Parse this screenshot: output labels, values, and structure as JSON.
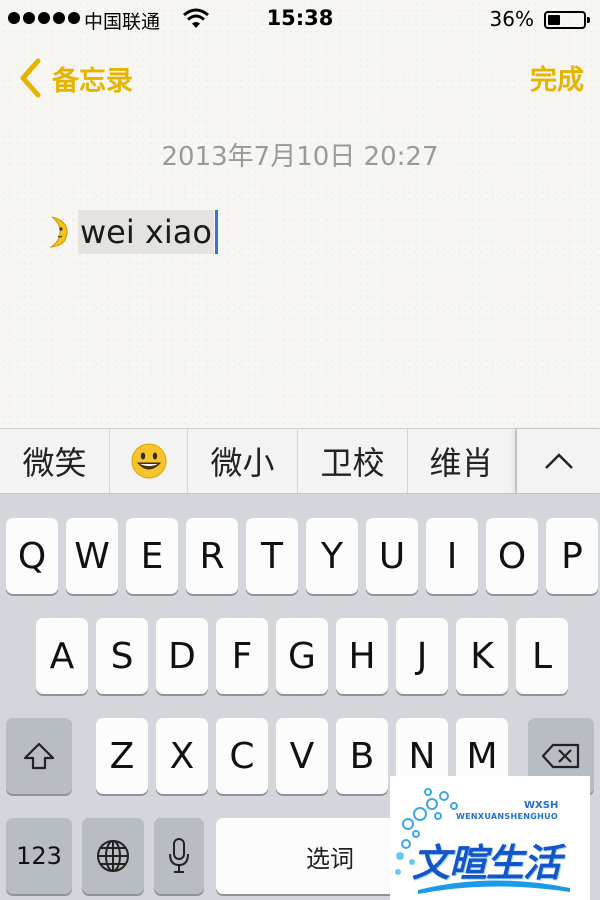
{
  "status_bar": {
    "carrier": "中国联通",
    "time": "15:38",
    "battery_percent": "36%",
    "battery_level": 0.36
  },
  "nav": {
    "back_label": "备忘录",
    "done_label": "完成",
    "accent_color": "#e6b400"
  },
  "note": {
    "date": "2013年7月10日 20:27",
    "text": "wei xiao"
  },
  "candidates": {
    "items": [
      "微笑",
      "smiling-face-emoji",
      "微小",
      "卫校",
      "维肖"
    ],
    "expand_icon": "chevron-up-icon"
  },
  "keyboard": {
    "row1": [
      "Q",
      "W",
      "E",
      "R",
      "T",
      "Y",
      "U",
      "I",
      "O",
      "P"
    ],
    "row2": [
      "A",
      "S",
      "D",
      "F",
      "G",
      "H",
      "J",
      "K",
      "L"
    ],
    "row3": [
      "Z",
      "X",
      "C",
      "V",
      "B",
      "N",
      "M"
    ],
    "shift_icon": "shift-icon",
    "delete_icon": "delete-icon",
    "numbers_label": "123",
    "globe_icon": "globe-icon",
    "mic_icon": "microphone-icon",
    "space_label": "选词"
  },
  "watermark": {
    "text_main": "文暄生活",
    "text_sub": "WENXUANSHENGHUO",
    "text_top": "WXSH"
  }
}
